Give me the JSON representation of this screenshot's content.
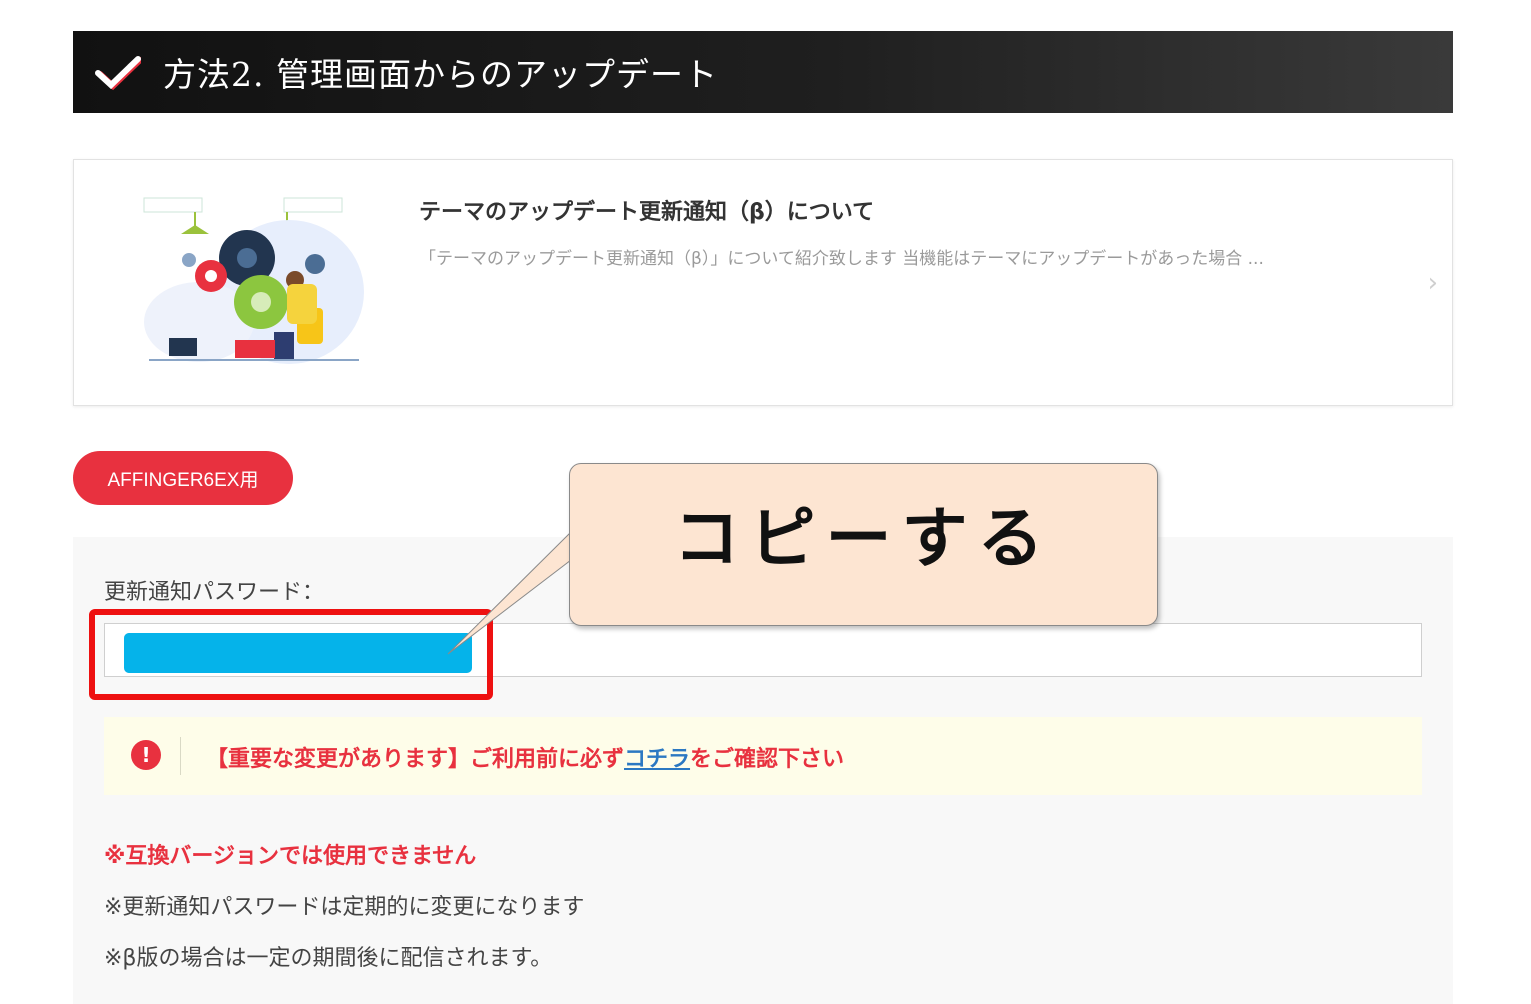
{
  "heading": {
    "title": "方法2. 管理画面からのアップデート"
  },
  "card": {
    "title": "テーマのアップデート更新通知（β）について",
    "excerpt": "「テーマのアップデート更新通知（β）」について紹介致します 当機能はテーマにアップデートがあった場合 ...",
    "chevron": "›"
  },
  "tag": {
    "label": "AFFINGER6EX用"
  },
  "password": {
    "label": "更新通知パスワード："
  },
  "notice": {
    "icon": "!",
    "text_before": "【重要な変更があります】ご利用前に必ず",
    "link": "コチラ",
    "text_after": "をご確認下さい"
  },
  "notes": {
    "warning": "※互換バージョンでは使用できません",
    "line1": "※更新通知パスワードは定期的に変更になります",
    "line2": "※β版の場合は一定の期間後に配信されます。"
  },
  "callout": {
    "text": "コピーする"
  },
  "colors": {
    "accent_red": "#e8313f",
    "value_blue": "#05b3ea",
    "callout_bg": "#fde5d2",
    "link": "#2b78c2"
  }
}
